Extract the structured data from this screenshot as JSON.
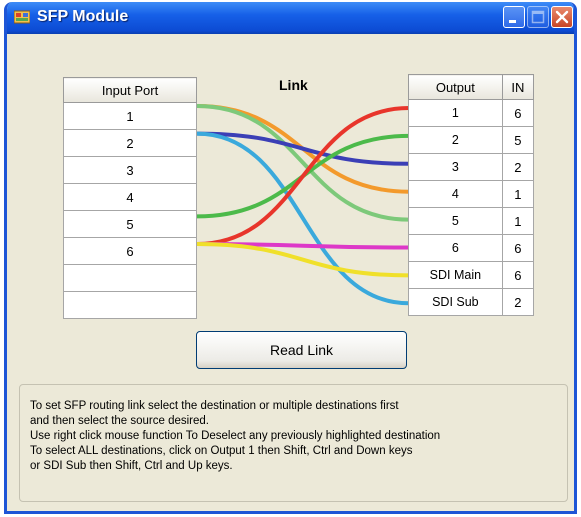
{
  "window": {
    "title": "SFP Module"
  },
  "input_table": {
    "header": "Input Port",
    "rows": [
      "1",
      "2",
      "3",
      "4",
      "5",
      "6",
      "",
      ""
    ]
  },
  "link_label": "Link",
  "output_table": {
    "header_output": "Output",
    "header_in": "IN",
    "rows": [
      {
        "output": "1",
        "in": "6"
      },
      {
        "output": "2",
        "in": "5"
      },
      {
        "output": "3",
        "in": "2"
      },
      {
        "output": "4",
        "in": "1"
      },
      {
        "output": "5",
        "in": "1"
      },
      {
        "output": "6",
        "in": "6"
      },
      {
        "output": "SDI Main",
        "in": "6"
      },
      {
        "output": "SDI Sub",
        "in": "2"
      }
    ]
  },
  "links": [
    {
      "from": "1",
      "to": "4",
      "color": "#f39a2c"
    },
    {
      "from": "1",
      "to": "5",
      "color": "#7dc97a"
    },
    {
      "from": "2",
      "to": "3",
      "color": "#3b3fb6"
    },
    {
      "from": "2",
      "to": "SDI Sub",
      "color": "#3aa9dc"
    },
    {
      "from": "5",
      "to": "2",
      "color": "#4cba4a"
    },
    {
      "from": "6",
      "to": "1",
      "color": "#e8352b"
    },
    {
      "from": "6",
      "to": "6",
      "color": "#dd38c8"
    },
    {
      "from": "6",
      "to": "SDI Main",
      "color": "#f0e02a"
    }
  ],
  "read_link_button": "Read Link",
  "help_lines": [
    "To set SFP routing link select the destination or multiple destinations first",
    "and then select the source desired.",
    "Use right click mouse function To Deselect any previously highlighted destination",
    "To select ALL destinations, click on Output 1 then Shift, Ctrl and Down keys",
    "or SDI Sub then Shift, Ctrl and Up keys."
  ]
}
